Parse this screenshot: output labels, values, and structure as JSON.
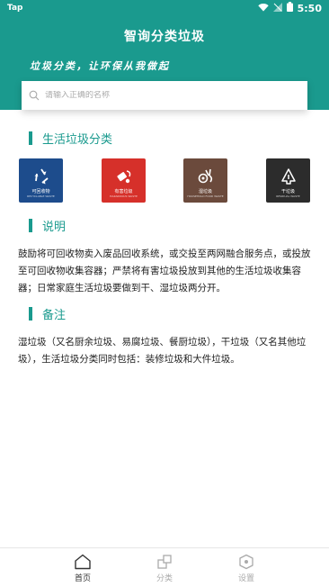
{
  "status_bar": {
    "carrier": "Tap",
    "time": "5:50"
  },
  "header": {
    "title": "智询分类垃圾",
    "slogan": "垃圾分类，让环保从我做起"
  },
  "search": {
    "placeholder": "请输入正确的名称",
    "value": ""
  },
  "sections": {
    "household": {
      "title": "生活垃圾分类"
    },
    "description": {
      "title": "说明",
      "text": "鼓励将可回收物卖入废品回收系统，或交投至两网融合服务点，或投放至可回收物收集容器；严禁将有害垃圾投放到其他的生活垃圾收集容器；日常家庭生活垃圾要做到干、湿垃圾两分开。"
    },
    "notes": {
      "title": "备注",
      "text": "湿垃圾（又名厨余垃圾、易腐垃圾、餐厨垃圾），干垃圾（又名其他垃圾），生活垃圾分类同时包括：装修垃圾和大件垃圾。"
    }
  },
  "bins": [
    {
      "label": "可回收物",
      "sub": "RECYCLABLE WASTE",
      "icon": "recycle-icon",
      "color": "#1d4c8c"
    },
    {
      "label": "有害垃圾",
      "sub": "HAZARDOUS WASTE",
      "icon": "hazardous-icon",
      "color": "#d6302a"
    },
    {
      "label": "湿垃圾",
      "sub": "HOUSEHOLD FOOD WASTE",
      "icon": "food-waste-icon",
      "color": "#6b4a3c"
    },
    {
      "label": "干垃圾",
      "sub": "RESIDUAL WASTE",
      "icon": "residual-waste-icon",
      "color": "#2c2c2c"
    }
  ],
  "tabbar": {
    "items": [
      {
        "label": "首页",
        "icon": "home-icon",
        "active": true
      },
      {
        "label": "分类",
        "icon": "category-icon",
        "active": false
      },
      {
        "label": "设置",
        "icon": "settings-icon",
        "active": false
      }
    ]
  },
  "colors": {
    "primary": "#1a9a8e",
    "tab_active": "#333333",
    "tab_inactive": "#aaaaaa"
  }
}
